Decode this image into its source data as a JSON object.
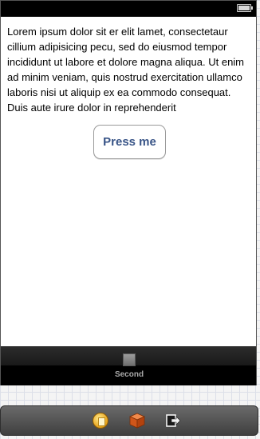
{
  "status_bar": {
    "battery_icon": "battery-icon"
  },
  "content": {
    "body_text": "Lorem ipsum dolor sit er elit lamet, consectetaur cillium adipisicing pecu, sed do eiusmod tempor incididunt ut labore et dolore magna aliqua. Ut enim ad minim veniam, quis nostrud exercitation ullamco laboris nisi ut aliquip ex ea commodo consequat. Duis aute irure dolor in reprehenderit",
    "button_label": "Press me"
  },
  "tab_bar": {
    "items": [
      {
        "label": "Second",
        "icon": "square-icon"
      }
    ]
  },
  "dock": {
    "icons": [
      "first-responder-icon",
      "cube-icon",
      "exit-icon"
    ]
  },
  "colors": {
    "button_text": "#385487",
    "tab_bar": "#000000",
    "grid_line": "#dcdfe8"
  }
}
